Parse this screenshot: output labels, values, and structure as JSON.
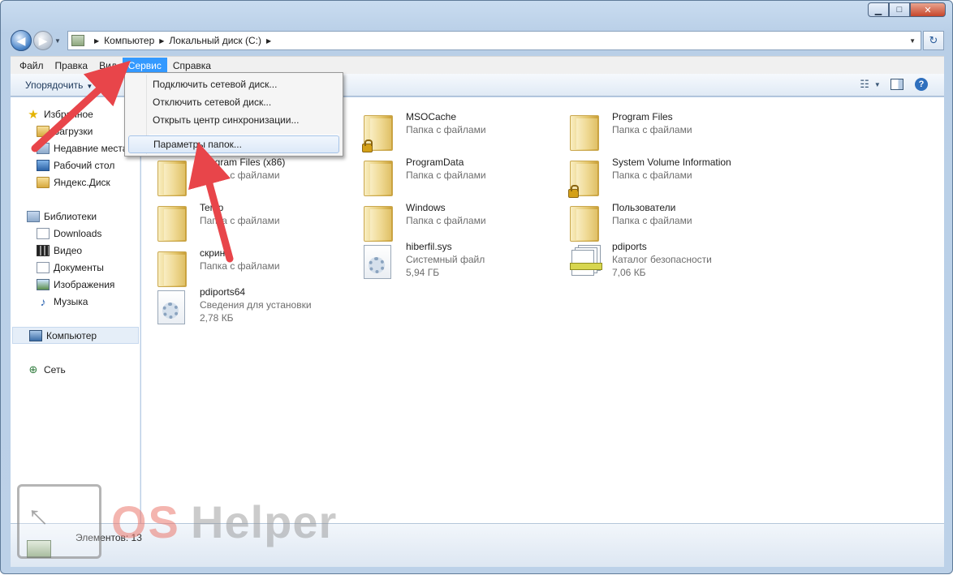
{
  "window": {
    "caption_buttons": {
      "minimize": "▁",
      "maximize": "□",
      "close": "✕"
    }
  },
  "address": {
    "crumbs": [
      "Компьютер",
      "Локальный диск (C:)"
    ],
    "back_glyph": "◀",
    "forward_glyph": "▶",
    "refresh_glyph": "↻"
  },
  "menu": {
    "items": [
      "Файл",
      "Правка",
      "Вид",
      "Сервис",
      "Справка"
    ],
    "active": "Сервис"
  },
  "commands": {
    "organize": "Упорядочить"
  },
  "dropdown": {
    "items": [
      "Подключить сетевой диск...",
      "Отключить сетевой диск...",
      "Открыть центр синхронизации...",
      "Параметры папок..."
    ],
    "highlighted": "Параметры папок..."
  },
  "nav": {
    "favorites": {
      "label": "Избранное",
      "items": [
        "Загрузки",
        "Недавние места",
        "Рабочий стол",
        "Яндекс.Диск"
      ]
    },
    "libraries": {
      "label": "Библиотеки",
      "items": [
        "Downloads",
        "Видео",
        "Документы",
        "Изображения",
        "Музыка"
      ]
    },
    "computer": {
      "label": "Компьютер"
    },
    "network": {
      "label": "Сеть"
    }
  },
  "files": [
    {
      "name": "MSOCache",
      "type": "Папка с файлами",
      "size": "",
      "icon": "folder-locked"
    },
    {
      "name": "Program Files",
      "type": "Папка с файлами",
      "size": "",
      "icon": "folder"
    },
    {
      "name": "Program Files (x86)",
      "type": "Папка с файлами",
      "size": "",
      "icon": "folder"
    },
    {
      "name": "ProgramData",
      "type": "Папка с файлами",
      "size": "",
      "icon": "folder"
    },
    {
      "name": "System Volume Information",
      "type": "Папка с файлами",
      "size": "",
      "icon": "folder-locked"
    },
    {
      "name": "Temp",
      "type": "Папка с файлами",
      "size": "",
      "icon": "folder"
    },
    {
      "name": "Windows",
      "type": "Папка с файлами",
      "size": "",
      "icon": "folder"
    },
    {
      "name": "Пользователи",
      "type": "Папка с файлами",
      "size": "",
      "icon": "folder"
    },
    {
      "name": "скрины",
      "type": "Папка с файлами",
      "size": "",
      "icon": "folder"
    },
    {
      "name": "hiberfil.sys",
      "type": "Системный файл",
      "size": "5,94 ГБ",
      "icon": "system-file"
    },
    {
      "name": "pdiports",
      "type": "Каталог безопасности",
      "size": "7,06 КБ",
      "icon": "catalog"
    },
    {
      "name": "pdiports64",
      "type": "Сведения для установки",
      "size": "2,78 КБ",
      "icon": "setup-info"
    }
  ],
  "status": {
    "items_count": "Элементов: 13"
  },
  "watermark": {
    "brand_os": "OS",
    "brand_helper": "Helper"
  },
  "colors": {
    "menu_active": "#3399ff",
    "arrow": "#e8454a"
  }
}
